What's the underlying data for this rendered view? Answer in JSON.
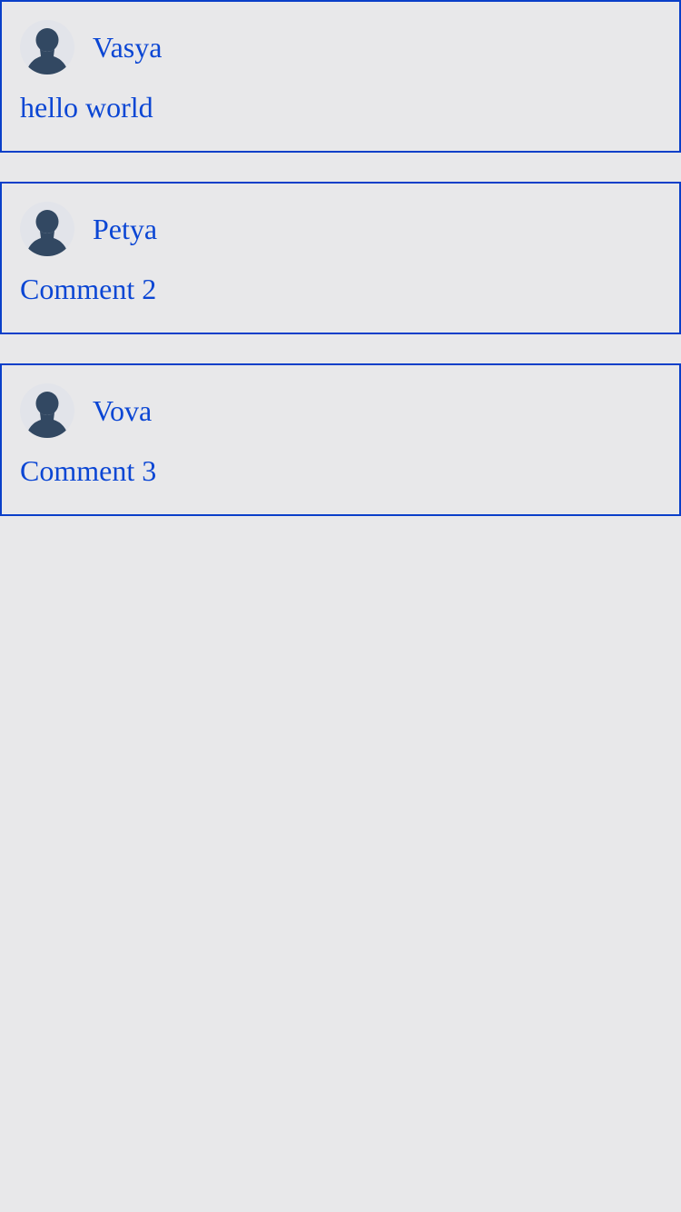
{
  "theme": {
    "background": "#e8e8ea",
    "accent": "#0b46d4",
    "border": "#0a3fc9",
    "avatar_fill": "#324862"
  },
  "comments": [
    {
      "author": "Vasya",
      "text": "hello world",
      "avatar_icon": "user-silhouette-icon"
    },
    {
      "author": "Petya",
      "text": "Comment 2",
      "avatar_icon": "user-silhouette-icon"
    },
    {
      "author": "Vova",
      "text": "Comment 3",
      "avatar_icon": "user-silhouette-icon"
    }
  ]
}
